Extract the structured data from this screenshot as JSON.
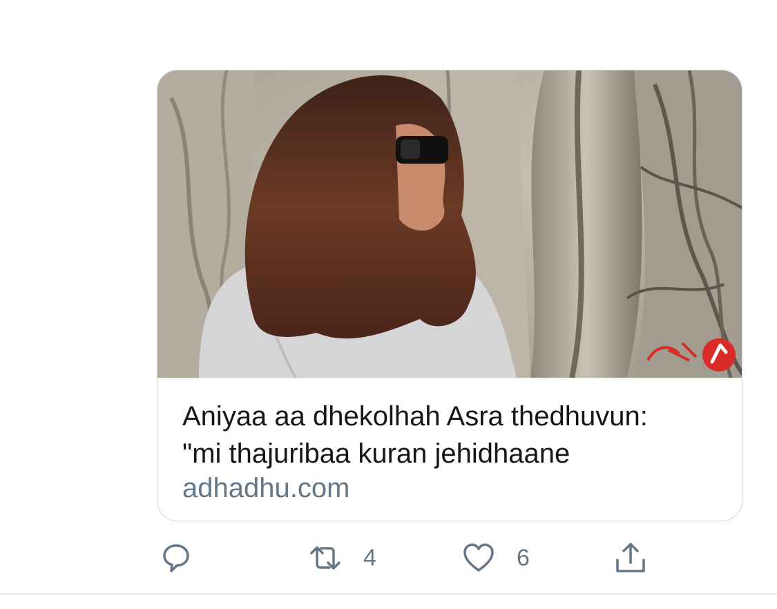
{
  "card": {
    "title": "Aniyaa aa dhekolhah Asra thedhuvun:\n\"mi thajuribaa kuran jehidhaane",
    "domain": "adhadhu.com",
    "image": "woman-in-sunglasses-by-tree-roots-photo"
  },
  "actions": {
    "reply": {
      "icon": "reply-icon"
    },
    "retweet": {
      "icon": "retweet-icon",
      "count": "4"
    },
    "like": {
      "icon": "heart-icon",
      "count": "6"
    },
    "share": {
      "icon": "share-icon"
    }
  },
  "colors": {
    "text": "#14171a",
    "muted": "#657786",
    "border": "#cfd9de",
    "logo_red": "#d92b27"
  }
}
